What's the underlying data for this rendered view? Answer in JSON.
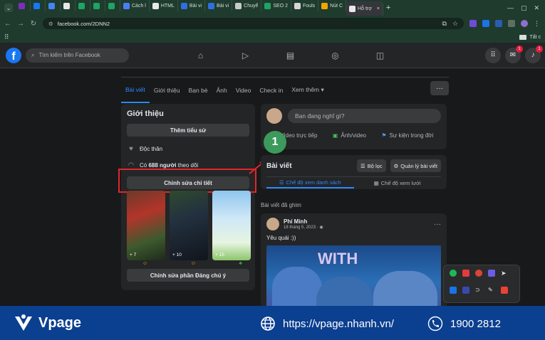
{
  "browser": {
    "tabs": [
      {
        "label": "",
        "color": "#7b2fbf"
      },
      {
        "label": "",
        "color": "#1877f2"
      },
      {
        "label": "",
        "color": "#4285f4"
      },
      {
        "label": "",
        "color": "#e8e8e8"
      },
      {
        "label": "",
        "color": "#1fa463"
      },
      {
        "label": "",
        "color": "#1fa463"
      },
      {
        "label": "",
        "color": "#1fa463"
      },
      {
        "label": "Cách l",
        "color": "#4a7ef0"
      },
      {
        "label": "HTML",
        "color": "#e8e8e8"
      },
      {
        "label": "Bài vi",
        "color": "#2f6fdf"
      },
      {
        "label": "Bài vi",
        "color": "#2f6fdf"
      },
      {
        "label": "Chuyể",
        "color": "#c9c9c9"
      },
      {
        "label": "SEO 2",
        "color": "#1fa463"
      },
      {
        "label": "Fouls",
        "color": "#d6d6d6"
      },
      {
        "label": "Nút C",
        "color": "#f2a600"
      },
      {
        "label": "Hỗ trợ",
        "color": "#e8e8e8"
      }
    ],
    "url": "facebook.com/2DNN2",
    "new_tab": "+"
  },
  "fb": {
    "search_placeholder": "Tìm kiếm trên Facebook",
    "notif_badge": "1",
    "msg_badge": "1"
  },
  "profile_tabs": [
    "Bài viết",
    "Giới thiệu",
    "Bạn bè",
    "Ảnh",
    "Video",
    "Check in",
    "Xem thêm ▾"
  ],
  "intro": {
    "title": "Giới thiệu",
    "add_bio": "Thêm tiểu sử",
    "status": "Độc thân",
    "followers_prefix": "Có ",
    "followers_count": "688 người",
    "followers_suffix": " theo dõi",
    "edit_details": "Chỉnh sửa chi tiết",
    "photo_counts": [
      "+ 7",
      "+ 10",
      "+ 15"
    ],
    "edit_featured": "Chỉnh sửa phần Đáng chú ý"
  },
  "composer": {
    "placeholder": "Bạn đang nghĩ gì?",
    "live": "Video trực tiếp",
    "photo": "Ảnh/video",
    "event": "Sự kiện trong đời"
  },
  "callout_number": "1",
  "posts": {
    "title": "Bài viết",
    "filter": "Bộ lọc",
    "manage": "Quản lý bài viết",
    "list_view": "Chế độ xem danh sách",
    "grid_view": "Chế độ xem lưới",
    "pinned": "Bài viết đã ghim"
  },
  "post": {
    "author": "Phí Minh",
    "date": "18 tháng 5, 2023 · ",
    "text": "Yêu quái :))",
    "image_label": "WITH"
  },
  "banner": {
    "brand": "Vpage",
    "url": "https://vpage.nhanh.vn/",
    "phone": "1900 2812"
  }
}
